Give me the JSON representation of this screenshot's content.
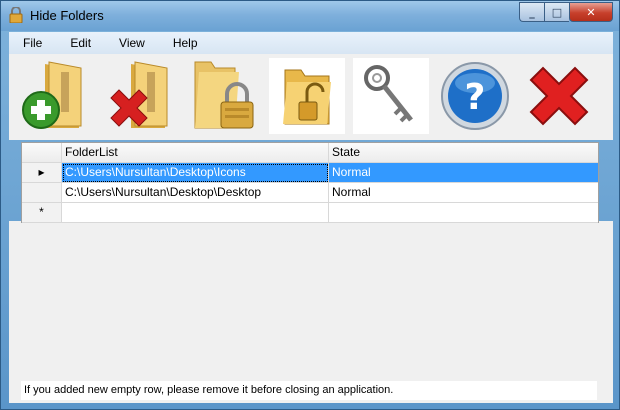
{
  "window": {
    "title": "Hide Folders",
    "icon": "lock-icon"
  },
  "menu": [
    "File",
    "Edit",
    "View",
    "Help"
  ],
  "toolbar": [
    {
      "name": "add-folder-button",
      "icon": "folder-add-icon"
    },
    {
      "name": "remove-folder-button",
      "icon": "folder-remove-icon"
    },
    {
      "name": "lock-folder-button",
      "icon": "folder-lock-icon"
    },
    {
      "name": "unlock-folder-button",
      "icon": "folder-unlock-icon"
    },
    {
      "name": "password-key-button",
      "icon": "key-icon"
    },
    {
      "name": "help-button",
      "icon": "help-icon"
    },
    {
      "name": "exit-button",
      "icon": "close-icon"
    }
  ],
  "grid": {
    "columns": [
      "FolderList",
      "State"
    ],
    "rows": [
      {
        "folder": "C:\\Users\\Nursultan\\Desktop\\Icons",
        "state": "Normal",
        "indicator": "▸"
      },
      {
        "folder": "C:\\Users\\Nursultan\\Desktop\\Desktop",
        "state": "Normal",
        "indicator": ""
      }
    ],
    "new_row_indicator": "*"
  },
  "status": "If you added  new empty  row, please remove it before closing an application.",
  "colors": {
    "selection": "#3399ff",
    "close_red": "#c7402c",
    "folder_yellow": "#e8c266"
  }
}
